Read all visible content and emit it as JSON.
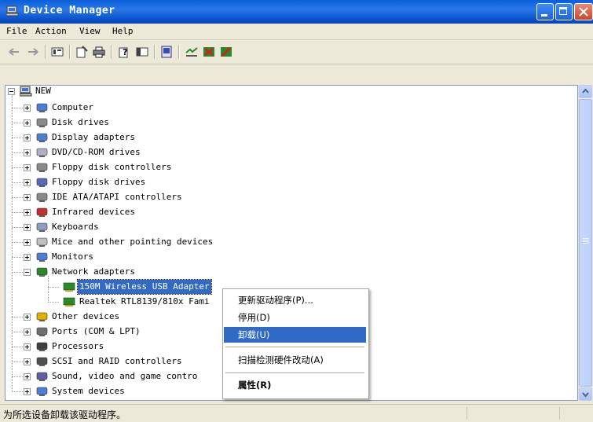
{
  "window": {
    "title": "Device Manager"
  },
  "menubar": {
    "items": [
      "File",
      "Action",
      "View",
      "Help"
    ]
  },
  "toolbar": {
    "icons": [
      "back-icon",
      "forward-icon",
      "view-icon",
      "properties-icon",
      "print-icon",
      "help-icon",
      "console-icon",
      "scan-icon",
      "update-driver-icon",
      "uninstall-icon",
      "disable-icon"
    ]
  },
  "tree": {
    "root": "NEW",
    "items": [
      {
        "label": "Computer",
        "icon": "computer-icon",
        "color": "#4a7fd4"
      },
      {
        "label": "Disk drives",
        "icon": "disk-drive-icon",
        "color": "#8a8a8a"
      },
      {
        "label": "Display adapters",
        "icon": "display-adapter-icon",
        "color": "#4a7fd4"
      },
      {
        "label": "DVD/CD-ROM drives",
        "icon": "dvd-icon",
        "color": "#b0b0c8"
      },
      {
        "label": "Floppy disk controllers",
        "icon": "controller-icon",
        "color": "#8a8a8a"
      },
      {
        "label": "Floppy disk drives",
        "icon": "floppy-icon",
        "color": "#5a6ab8"
      },
      {
        "label": "IDE ATA/ATAPI controllers",
        "icon": "ide-icon",
        "color": "#8a8a8a"
      },
      {
        "label": "Infrared devices",
        "icon": "infrared-icon",
        "color": "#c03030"
      },
      {
        "label": "Keyboards",
        "icon": "keyboard-icon",
        "color": "#8aa0c0"
      },
      {
        "label": "Mice and other pointing devices",
        "icon": "mouse-icon",
        "color": "#c0c0c0"
      },
      {
        "label": "Monitors",
        "icon": "monitor-icon",
        "color": "#4a7fd4"
      },
      {
        "label": "Network adapters",
        "icon": "network-adapter-icon",
        "color": "#2a8a2a",
        "expanded": true,
        "children": [
          {
            "label": "150M Wireless USB Adapter",
            "selected": true
          },
          {
            "label": "Realtek RTL8139/810x Fami"
          }
        ]
      },
      {
        "label": "Other devices",
        "icon": "unknown-device-icon",
        "color": "#e0b000"
      },
      {
        "label": "Ports (COM & LPT)",
        "icon": "port-icon",
        "color": "#707070"
      },
      {
        "label": "Processors",
        "icon": "processor-icon",
        "color": "#404040"
      },
      {
        "label": "SCSI and RAID controllers",
        "icon": "scsi-icon",
        "color": "#505050"
      },
      {
        "label": "Sound, video and game contro",
        "icon": "sound-icon",
        "color": "#6060a0"
      },
      {
        "label": "System devices",
        "icon": "system-device-icon",
        "color": "#4a7fd4"
      }
    ]
  },
  "context_menu": {
    "items": [
      {
        "label": "更新驱动程序(P)...",
        "bold": false
      },
      {
        "label": "停用(D)",
        "bold": false
      },
      {
        "label": "卸载(U)",
        "bold": false,
        "highlighted": true
      },
      {
        "label": "扫描检测硬件改动(A)",
        "bold": false
      },
      {
        "label": "属性(R)",
        "bold": true
      }
    ]
  },
  "status": {
    "text": "为所选设备卸载该驱动程序。"
  },
  "colors": {
    "titlebar": "#0a5fd8",
    "selection": "#316ac5",
    "face": "#ece9d8"
  }
}
